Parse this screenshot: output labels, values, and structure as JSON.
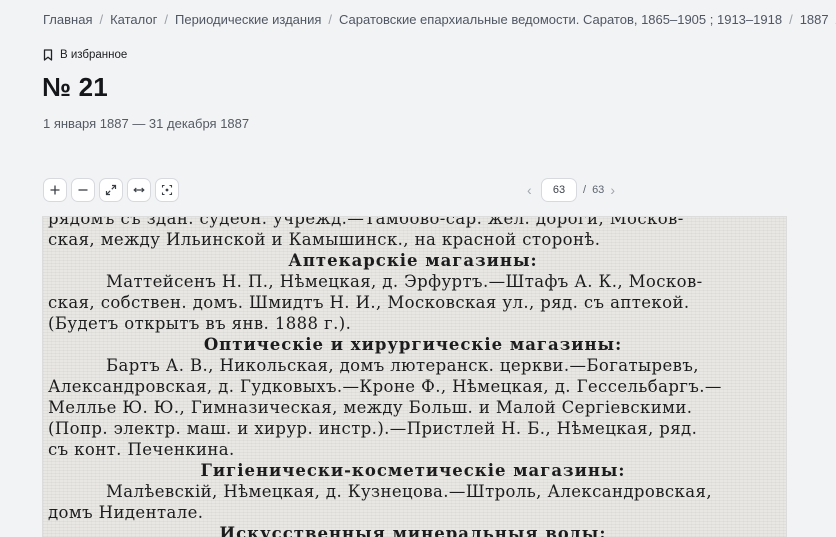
{
  "breadcrumbs": [
    "Главная",
    "Каталог",
    "Периодические издания",
    "Саратовские епархиальные ведомости. Саратов, 1865–1905 ; 1913–1918",
    "1887",
    "№"
  ],
  "favorite_label": "В избранное",
  "title": "№ 21",
  "dates": "1 января 1887 — 31 декабря 1887",
  "toolbar": {
    "zoom_in_icon": "plus-icon",
    "zoom_out_icon": "minus-icon",
    "fullscreen_icon": "expand-icon",
    "fit_width_icon": "fit-width-icon",
    "focus_icon": "focus-icon"
  },
  "pager": {
    "prev": "‹",
    "current": "63",
    "separator": "/",
    "total": "63",
    "next": "›"
  },
  "scan": {
    "lines": [
      {
        "type": "text",
        "text": "рядомъ съ здан. судебн. учрежд.—Тамбово-сар. жел. дороги, Москов-"
      },
      {
        "type": "text",
        "text": "ская, между Ильинской и Камышинск., на красной сторонѣ."
      },
      {
        "type": "heading",
        "text": "Аптекарскіе магазины:"
      },
      {
        "type": "indent",
        "text": "Маттейсенъ Н. П., Нѣмецкая, д. Эрфуртъ.—Штафъ А. К., Москов-"
      },
      {
        "type": "text",
        "text": "ская, собствен. домъ. Шмидтъ Н. И., Московская ул., ряд. съ аптекой."
      },
      {
        "type": "text",
        "text": "(Будетъ открытъ въ янв. 1888 г.)."
      },
      {
        "type": "heading",
        "text": "Оптическіе и хирургическіе магазины:"
      },
      {
        "type": "indent",
        "text": "Бартъ А. В., Никольская, домъ лютеранск. церкви.—Богатыревъ,"
      },
      {
        "type": "text",
        "text": "Александровская, д. Гудковыхъ.—Кроне Ф., Нѣмецкая, д. Гессельбаргъ.—"
      },
      {
        "type": "text",
        "text": "Меллье Ю. Ю., Гимназическая, между Больш. и Малой Сергіевскими."
      },
      {
        "type": "text",
        "text": "(Попр. электр. маш. и хирур. инстр.).—Пристлей Н. Б., Нѣмецкая, ряд."
      },
      {
        "type": "text",
        "text": "съ конт. Печенкина."
      },
      {
        "type": "heading",
        "text": "Гигіенически-косметическіе магазины:"
      },
      {
        "type": "indent",
        "text": "Малѣевскій, Нѣмецкая, д. Кузнецова.—Штроль, Александровская,"
      },
      {
        "type": "text",
        "text": "домъ Нидентале."
      },
      {
        "type": "heading",
        "text": "Искусственныя минеральныя воды:"
      }
    ]
  },
  "colors": {
    "page_bg": "#f2f3f5",
    "text": "#202124",
    "muted": "#555b64",
    "scan_bg": "#e8e7e4"
  }
}
